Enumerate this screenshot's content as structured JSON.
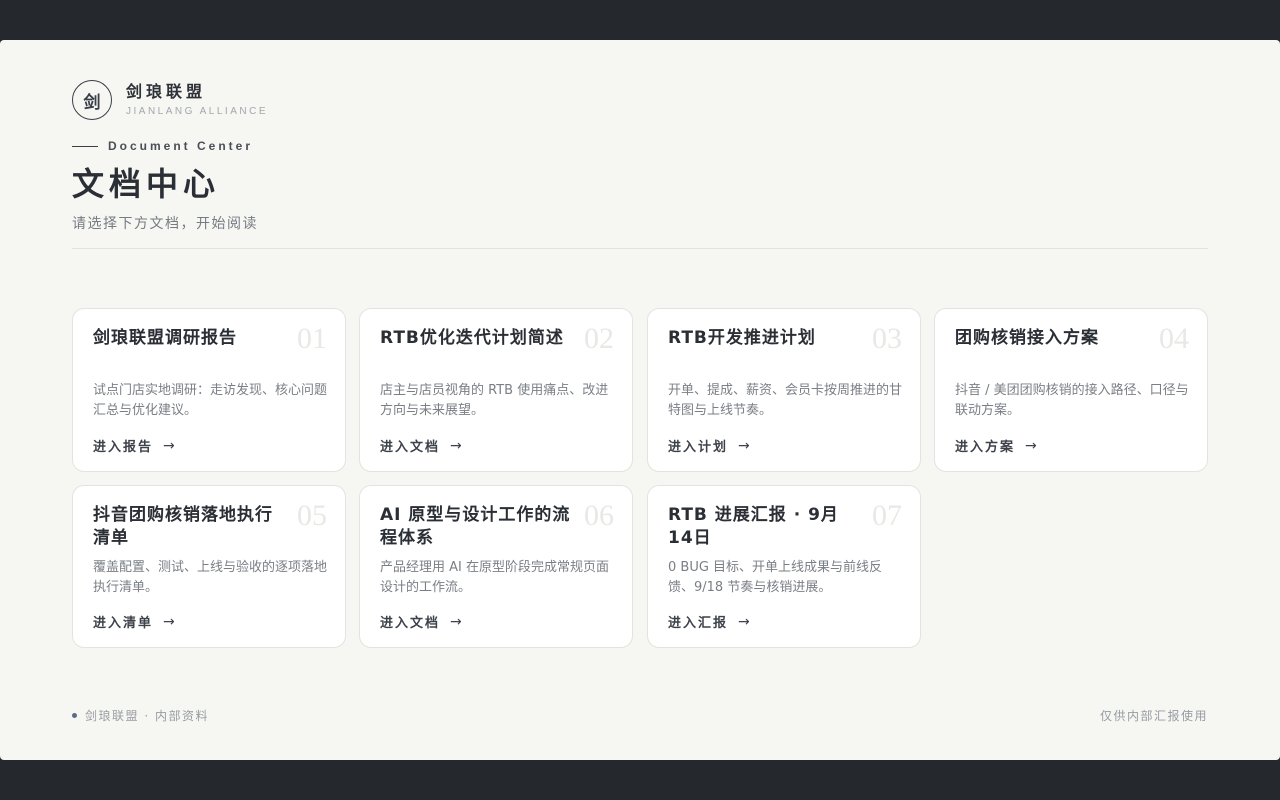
{
  "brand": {
    "logo_char": "剑",
    "name": "剑琅联盟",
    "name_en": "JIANLANG ALLIANCE"
  },
  "header": {
    "eyebrow": "Document Center",
    "title": "文档中心",
    "subtitle": "请选择下方文档，开始阅读"
  },
  "cards": [
    {
      "num": "01",
      "title": "剑琅联盟调研报告",
      "desc": "试点门店实地调研：走访发现、核心问题汇总与优化建议。",
      "link": "进入报告",
      "arrow": "→"
    },
    {
      "num": "02",
      "title": "RTB优化迭代计划简述",
      "desc": "店主与店员视角的 RTB 使用痛点、改进方向与未来展望。",
      "link": "进入文档",
      "arrow": "→"
    },
    {
      "num": "03",
      "title": "RTB开发推进计划",
      "desc": "开单、提成、薪资、会员卡按周推进的甘特图与上线节奏。",
      "link": "进入计划",
      "arrow": "→"
    },
    {
      "num": "04",
      "title": "团购核销接入方案",
      "desc": "抖音 / 美团团购核销的接入路径、口径与联动方案。",
      "link": "进入方案",
      "arrow": "→"
    },
    {
      "num": "05",
      "title": "抖音团购核销落地执行清单",
      "desc": "覆盖配置、测试、上线与验收的逐项落地执行清单。",
      "link": "进入清单",
      "arrow": "→"
    },
    {
      "num": "06",
      "title": "AI 原型与设计工作的流程体系",
      "desc": "产品经理用 AI 在原型阶段完成常规页面设计的工作流。",
      "link": "进入文档",
      "arrow": "→"
    },
    {
      "num": "07",
      "title": "RTB 进展汇报 · 9月14日",
      "desc": "0 BUG 目标、开单上线成果与前线反馈、9/18 节奏与核销进展。",
      "link": "进入汇报",
      "arrow": "→"
    }
  ],
  "footer": {
    "left": "剑琅联盟 · 内部资料",
    "right": "仅供内部汇报使用"
  }
}
